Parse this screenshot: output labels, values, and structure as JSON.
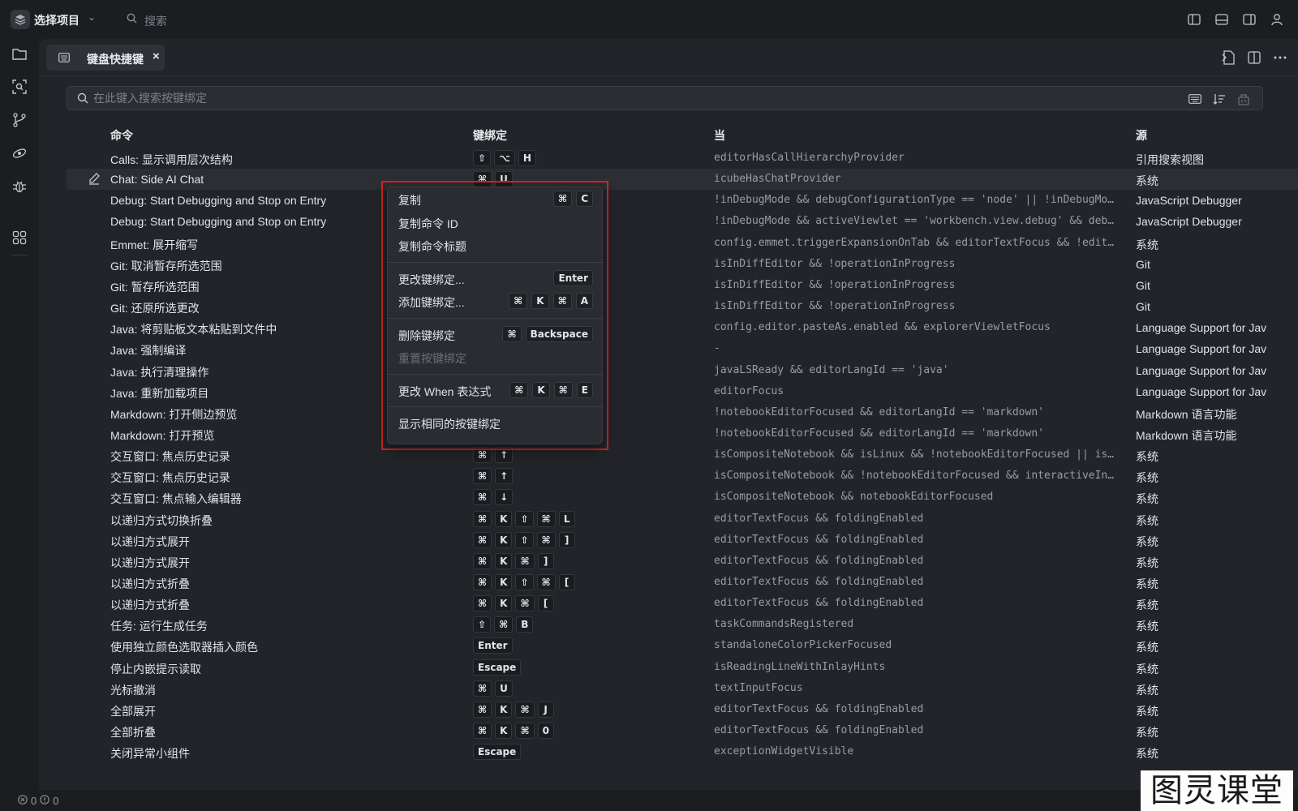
{
  "titlebar": {
    "project_label": "选择项目",
    "search_placeholder": "搜索"
  },
  "tab": {
    "label": "键盘快捷键",
    "close": "×"
  },
  "search": {
    "placeholder": "在此键入搜索按键绑定",
    "value": ""
  },
  "table": {
    "headers": {
      "command": "命令",
      "keybinding": "键绑定",
      "when": "当",
      "source": "源"
    },
    "rows": [
      {
        "command": "Calls: 显示调用层次结构",
        "keys": [
          "⇧",
          "⌥",
          "H"
        ],
        "when": "editorHasCallHierarchyProvider",
        "source": "引用搜索视图"
      },
      {
        "command": "Chat: Side AI Chat",
        "keys": [
          "⌘",
          "U"
        ],
        "when": "icubeHasChatProvider",
        "source": "系统",
        "selected": true
      },
      {
        "command": "Debug: Start Debugging and Stop on Entry",
        "keys": [],
        "when": "!inDebugMode && debugConfigurationType == 'node' || !inDebugMode …",
        "source": "JavaScript Debugger"
      },
      {
        "command": "Debug: Start Debugging and Stop on Entry",
        "keys": [],
        "when": "!inDebugMode && activeViewlet == 'workbench.view.debug' && debugC…",
        "source": "JavaScript Debugger"
      },
      {
        "command": "Emmet: 展开缩写",
        "keys": [],
        "when": "config.emmet.triggerExpansionOnTab && editorTextFocus && !editorR…",
        "source": "系统"
      },
      {
        "command": "Git: 取消暂存所选范围",
        "keys": [],
        "when": "isInDiffEditor && !operationInProgress",
        "source": "Git"
      },
      {
        "command": "Git: 暂存所选范围",
        "keys": [],
        "when": "isInDiffEditor && !operationInProgress",
        "source": "Git"
      },
      {
        "command": "Git: 还原所选更改",
        "keys": [],
        "when": "isInDiffEditor && !operationInProgress",
        "source": "Git"
      },
      {
        "command": "Java: 将剪贴板文本粘贴到文件中",
        "keys": [],
        "when": "config.editor.pasteAs.enabled && explorerViewletFocus",
        "source": "Language Support for Jav"
      },
      {
        "command": "Java: 强制编译",
        "keys": [],
        "when": "-",
        "source": "Language Support for Jav"
      },
      {
        "command": "Java: 执行清理操作",
        "keys": [],
        "when": "javaLSReady && editorLangId == 'java'",
        "source": "Language Support for Jav"
      },
      {
        "command": "Java: 重新加载项目",
        "keys": [],
        "when": "editorFocus",
        "source": "Language Support for Jav"
      },
      {
        "command": "Markdown: 打开侧边预览",
        "keys": [],
        "when": "!notebookEditorFocused && editorLangId == 'markdown'",
        "source": "Markdown 语言功能"
      },
      {
        "command": "Markdown: 打开预览",
        "keys": [],
        "when": "!notebookEditorFocused && editorLangId == 'markdown'",
        "source": "Markdown 语言功能"
      },
      {
        "command": "交互窗口: 焦点历史记录",
        "keys": [
          "⌘",
          "↑"
        ],
        "when": "isCompositeNotebook && isLinux && !notebookEditorFocused || isCom…",
        "source": "系统"
      },
      {
        "command": "交互窗口: 焦点历史记录",
        "keys": [
          "⌘",
          "↑"
        ],
        "when": "isCompositeNotebook && !notebookEditorFocused && interactiveInput…",
        "source": "系统"
      },
      {
        "command": "交互窗口: 焦点输入编辑器",
        "keys": [
          "⌘",
          "↓"
        ],
        "when": "isCompositeNotebook && notebookEditorFocused",
        "source": "系统"
      },
      {
        "command": "以递归方式切换折叠",
        "keys": [
          "⌘",
          "K",
          "⇧",
          "⌘",
          "L"
        ],
        "when": "editorTextFocus && foldingEnabled",
        "source": "系统"
      },
      {
        "command": "以递归方式展开",
        "keys": [
          "⌘",
          "K",
          "⇧",
          "⌘",
          "]"
        ],
        "when": "editorTextFocus && foldingEnabled",
        "source": "系统"
      },
      {
        "command": "以递归方式展开",
        "keys": [
          "⌘",
          "K",
          "⌘",
          "]"
        ],
        "when": "editorTextFocus && foldingEnabled",
        "source": "系统"
      },
      {
        "command": "以递归方式折叠",
        "keys": [
          "⌘",
          "K",
          "⇧",
          "⌘",
          "["
        ],
        "when": "editorTextFocus && foldingEnabled",
        "source": "系统"
      },
      {
        "command": "以递归方式折叠",
        "keys": [
          "⌘",
          "K",
          "⌘",
          "["
        ],
        "when": "editorTextFocus && foldingEnabled",
        "source": "系统"
      },
      {
        "command": "任务: 运行生成任务",
        "keys": [
          "⇧",
          "⌘",
          "B"
        ],
        "when": "taskCommandsRegistered",
        "source": "系统"
      },
      {
        "command": "使用独立颜色选取器插入颜色",
        "keys": [
          "Enter"
        ],
        "when": "standaloneColorPickerFocused",
        "source": "系统"
      },
      {
        "command": "停止内嵌提示读取",
        "keys": [
          "Escape"
        ],
        "when": "isReadingLineWithInlayHints",
        "source": "系统"
      },
      {
        "command": "光标撤消",
        "keys": [
          "⌘",
          "U"
        ],
        "when": "textInputFocus",
        "source": "系统"
      },
      {
        "command": "全部展开",
        "keys": [
          "⌘",
          "K",
          "⌘",
          "J"
        ],
        "when": "editorTextFocus && foldingEnabled",
        "source": "系统"
      },
      {
        "command": "全部折叠",
        "keys": [
          "⌘",
          "K",
          "⌘",
          "0"
        ],
        "when": "editorTextFocus && foldingEnabled",
        "source": "系统"
      },
      {
        "command": "关闭异常小组件",
        "keys": [
          "Escape"
        ],
        "when": "exceptionWidgetVisible",
        "source": "系统"
      }
    ]
  },
  "context_menu": {
    "items": [
      {
        "label": "复制",
        "keys": [
          "⌘",
          "C"
        ]
      },
      {
        "label": "复制命令 ID",
        "keys": []
      },
      {
        "label": "复制命令标题",
        "keys": []
      },
      {
        "label": "更改键绑定...",
        "keys": [
          "Enter"
        ],
        "sep_before": true
      },
      {
        "label": "添加键绑定...",
        "keys": [
          "⌘",
          "K",
          "⌘",
          "A"
        ]
      },
      {
        "label": "删除键绑定",
        "keys": [
          "⌘",
          "Backspace"
        ],
        "sep_before": true
      },
      {
        "label": "重置按键绑定",
        "keys": [],
        "disabled": true
      },
      {
        "label": "更改 When 表达式",
        "keys": [
          "⌘",
          "K",
          "⌘",
          "E"
        ],
        "sep_before": true
      },
      {
        "label": "显示相同的按键绑定",
        "keys": [],
        "sep_before": true
      }
    ]
  },
  "statusbar": {
    "errors": "0",
    "warnings": "0"
  },
  "watermark": "图灵课堂",
  "colors": {
    "highlight": "#d9221d",
    "background": "#1c1d21",
    "editor": "#232429"
  }
}
